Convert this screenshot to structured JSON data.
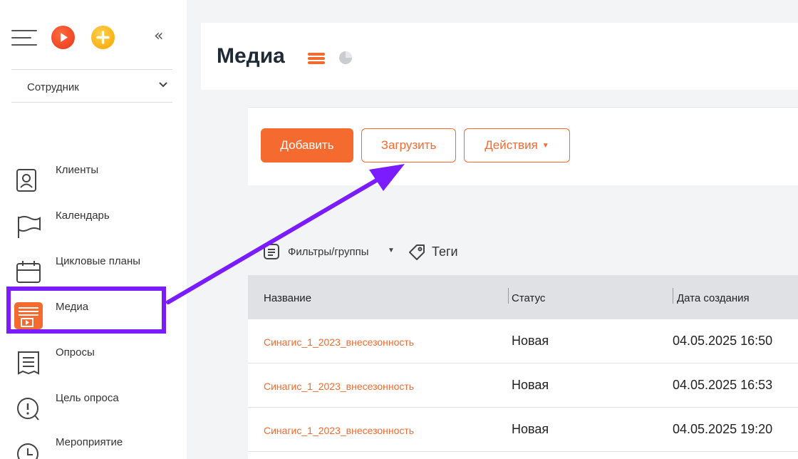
{
  "sidebar": {
    "role": "Сотрудник",
    "items": [
      {
        "label": "Клиенты",
        "icon": "client-card-icon"
      },
      {
        "label": "Календарь",
        "icon": "flag-icon"
      },
      {
        "label": "Цикловые планы",
        "icon": "calendar-icon"
      },
      {
        "label": "Медиа",
        "icon": "media-icon",
        "active": true
      },
      {
        "label": "Опросы",
        "icon": "survey-list-icon"
      },
      {
        "label": "Цель опроса",
        "icon": "survey-goal-icon"
      },
      {
        "label": "Мероприятие",
        "icon": "clock-icon"
      }
    ]
  },
  "header": {
    "title": "Медиа"
  },
  "toolbar": {
    "add_label": "Добавить",
    "upload_label": "Загрузить",
    "actions_label": "Действия"
  },
  "filters": {
    "filters_label": "Фильтры/группы",
    "tags_label": "Теги"
  },
  "table": {
    "columns": [
      "Название",
      "Статус",
      "Дата создания"
    ],
    "rows": [
      {
        "name": "Синагис_1_2023_внесезонность",
        "status": "Новая",
        "created": "04.05.2025 16:50"
      },
      {
        "name": "Синагис_1_2023_внесезонность",
        "status": "Новая",
        "created": "04.05.2025 16:53"
      },
      {
        "name": "Синагис_1_2023_внесезонность",
        "status": "Новая",
        "created": "04.05.2025 19:20"
      }
    ]
  },
  "colors": {
    "accent": "#f46a2f",
    "highlight": "#7a1cff"
  }
}
